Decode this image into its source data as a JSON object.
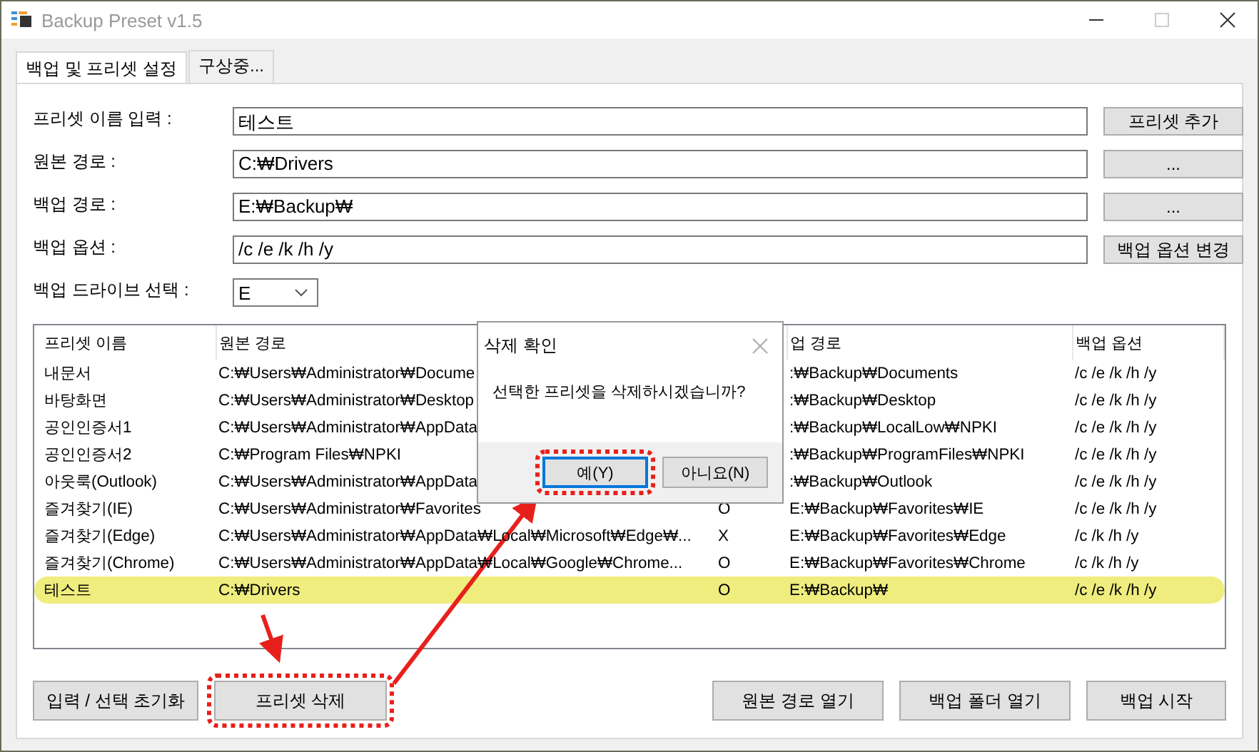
{
  "window": {
    "title": "Backup Preset v1.5"
  },
  "tabs": [
    {
      "label": "백업 및 프리셋 설정",
      "selected": true
    },
    {
      "label": "구상중...",
      "selected": false
    }
  ],
  "form": [
    {
      "label": "프리셋 이름 입력 :",
      "value": "테스트",
      "button": "프리셋 추가"
    },
    {
      "label": "원본 경로 :",
      "value": "C:₩Drivers",
      "button": "..."
    },
    {
      "label": "백업 경로 :",
      "value": "E:₩Backup₩",
      "button": "..."
    },
    {
      "label": "백업 옵션 :",
      "value": "/c /e /k /h /y",
      "button": "백업 옵션 변경"
    }
  ],
  "drive": {
    "label": "백업 드라이브 선택 :",
    "value": "E"
  },
  "table": {
    "header": {
      "name": "프리셋 이름",
      "source": "원본 경로",
      "backup": "업 경로",
      "options": "백업 옵션"
    },
    "rows": [
      {
        "name": "내문서",
        "source": "C:₩Users₩Administrator₩Docume",
        "backup": ":₩Backup₩Documents",
        "options": "/c /e /k /h /y",
        "selected": false
      },
      {
        "name": "바탕화면",
        "source": "C:₩Users₩Administrator₩Desktop",
        "backup": ":₩Backup₩Desktop",
        "options": "/c /e /k /h /y",
        "selected": false
      },
      {
        "name": "공인인증서1",
        "source": "C:₩Users₩Administrator₩AppData",
        "backup": ":₩Backup₩LocalLow₩NPKI",
        "options": "/c /e /k /h /y",
        "selected": false
      },
      {
        "name": "공인인증서2",
        "source": "C:₩Program Files₩NPKI",
        "backup": ":₩Backup₩ProgramFiles₩NPKI",
        "options": "/c /e /k /h /y",
        "selected": false
      },
      {
        "name": "아웃룩(Outlook)",
        "source": "C:₩Users₩Administrator₩AppData",
        "backup": ":₩Backup₩Outlook",
        "options": "/c /e /k /h /y",
        "selected": false
      },
      {
        "name": "즐겨찾기(IE)",
        "source": "C:₩Users₩Administrator₩Favorites",
        "column_3": "O",
        "backup": "E:₩Backup₩Favorites₩IE",
        "options": "/c /e /k /h /y",
        "selected": false
      },
      {
        "name": "즐겨찾기(Edge)",
        "source": "C:₩Users₩Administrator₩AppData₩Local₩Microsoft₩Edge₩...",
        "column_3": "X",
        "backup": "E:₩Backup₩Favorites₩Edge",
        "options": "/c /k /h /y",
        "selected": false
      },
      {
        "name": "즐겨찾기(Chrome)",
        "source": "C:₩Users₩Administrator₩AppData₩Local₩Google₩Chrome...",
        "column_3": "O",
        "backup": "E:₩Backup₩Favorites₩Chrome",
        "options": "/c /k /h /y",
        "selected": false
      },
      {
        "name": "테스트",
        "source": "C:₩Drivers",
        "column_3": "O",
        "backup": "E:₩Backup₩",
        "options": "/c /e /k /h /y",
        "selected": true
      }
    ]
  },
  "buttons_left": [
    {
      "label": "입력 / 선택 초기화",
      "highlighted": false
    },
    {
      "label": "프리셋 삭제",
      "highlighted": true
    }
  ],
  "buttons_right": [
    {
      "label": "원본 경로 열기",
      "highlighted": false
    },
    {
      "label": "백업 폴더 열기",
      "highlighted": false
    },
    {
      "label": "백업 시작",
      "highlighted": false
    }
  ],
  "dialog": {
    "title": "삭제 확인",
    "message": "선택한 프리셋을 삭제하시겠습니까?",
    "buttons": [
      {
        "label": "예(Y)",
        "focused": true,
        "highlighted": true
      },
      {
        "label": "아니요(N)",
        "focused": false,
        "highlighted": false
      }
    ]
  }
}
